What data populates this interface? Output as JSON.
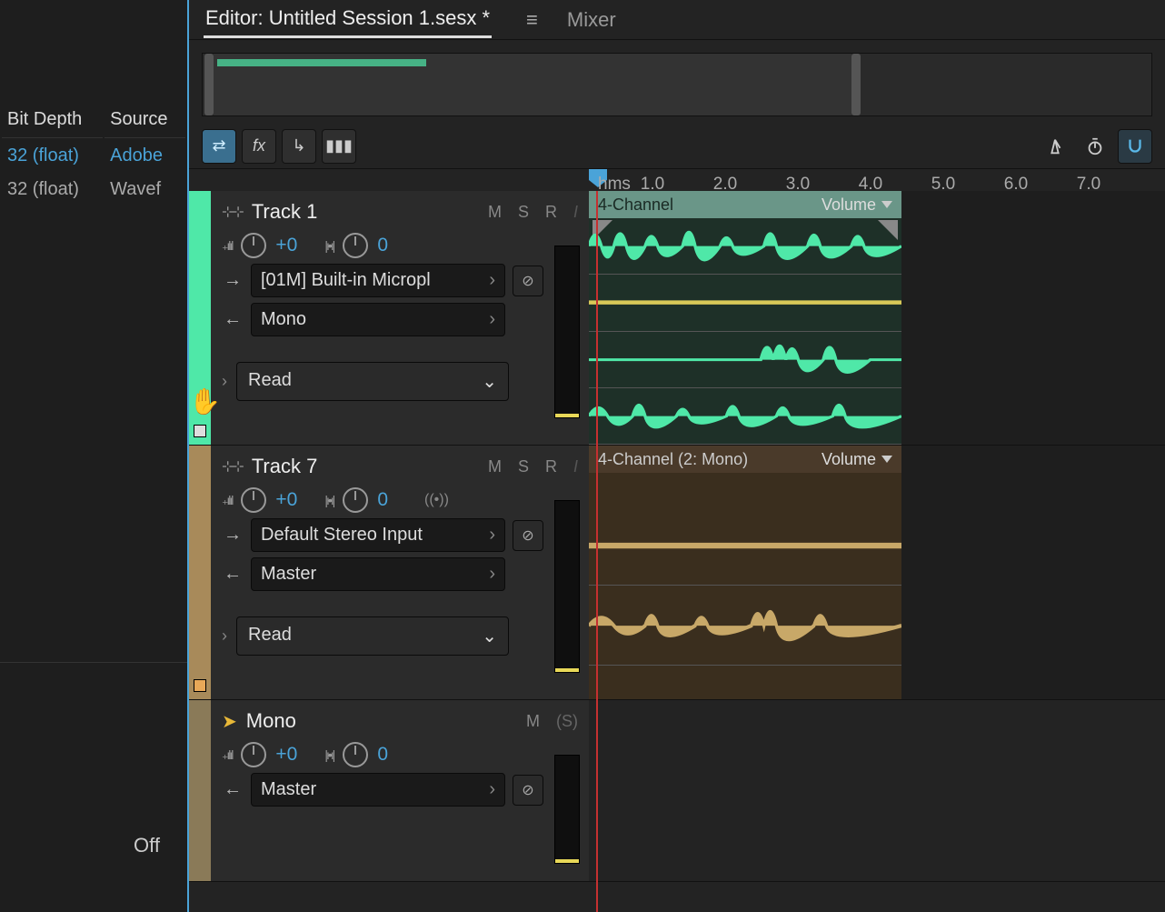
{
  "tabs": {
    "editor": "Editor: Untitled Session 1.sesx *",
    "mixer": "Mixer"
  },
  "columns": {
    "bitdepth": "Bit Depth",
    "source": "Source"
  },
  "rows": [
    {
      "bitdepth": "32 (float)",
      "source": "Adobe"
    },
    {
      "bitdepth": "32 (float)",
      "source": "Wavef"
    }
  ],
  "off_label": "Off",
  "ruler_unit": "hms",
  "ruler_ticks": [
    "1.0",
    "2.0",
    "3.0",
    "4.0",
    "5.0",
    "6.0",
    "7.0"
  ],
  "tracks": [
    {
      "name": "Track 1",
      "color": "green",
      "vol": "+0",
      "pan": "0",
      "input": "[01M] Built-in Micropl",
      "output": "Mono",
      "automation": "Read",
      "clip": {
        "label": "4-Channel",
        "volume_label": "Volume"
      }
    },
    {
      "name": "Track 7",
      "color": "tan",
      "vol": "+0",
      "pan": "0",
      "input": "Default Stereo Input",
      "output": "Master",
      "automation": "Read",
      "clip": {
        "label": "4-Channel (2: Mono)",
        "volume_label": "Volume"
      }
    },
    {
      "name": "Mono",
      "color": "tan2",
      "is_bus": true,
      "vol": "+0",
      "pan": "0",
      "output": "Master"
    }
  ],
  "msr": {
    "m": "M",
    "s": "S",
    "r": "R",
    "i": "I"
  }
}
